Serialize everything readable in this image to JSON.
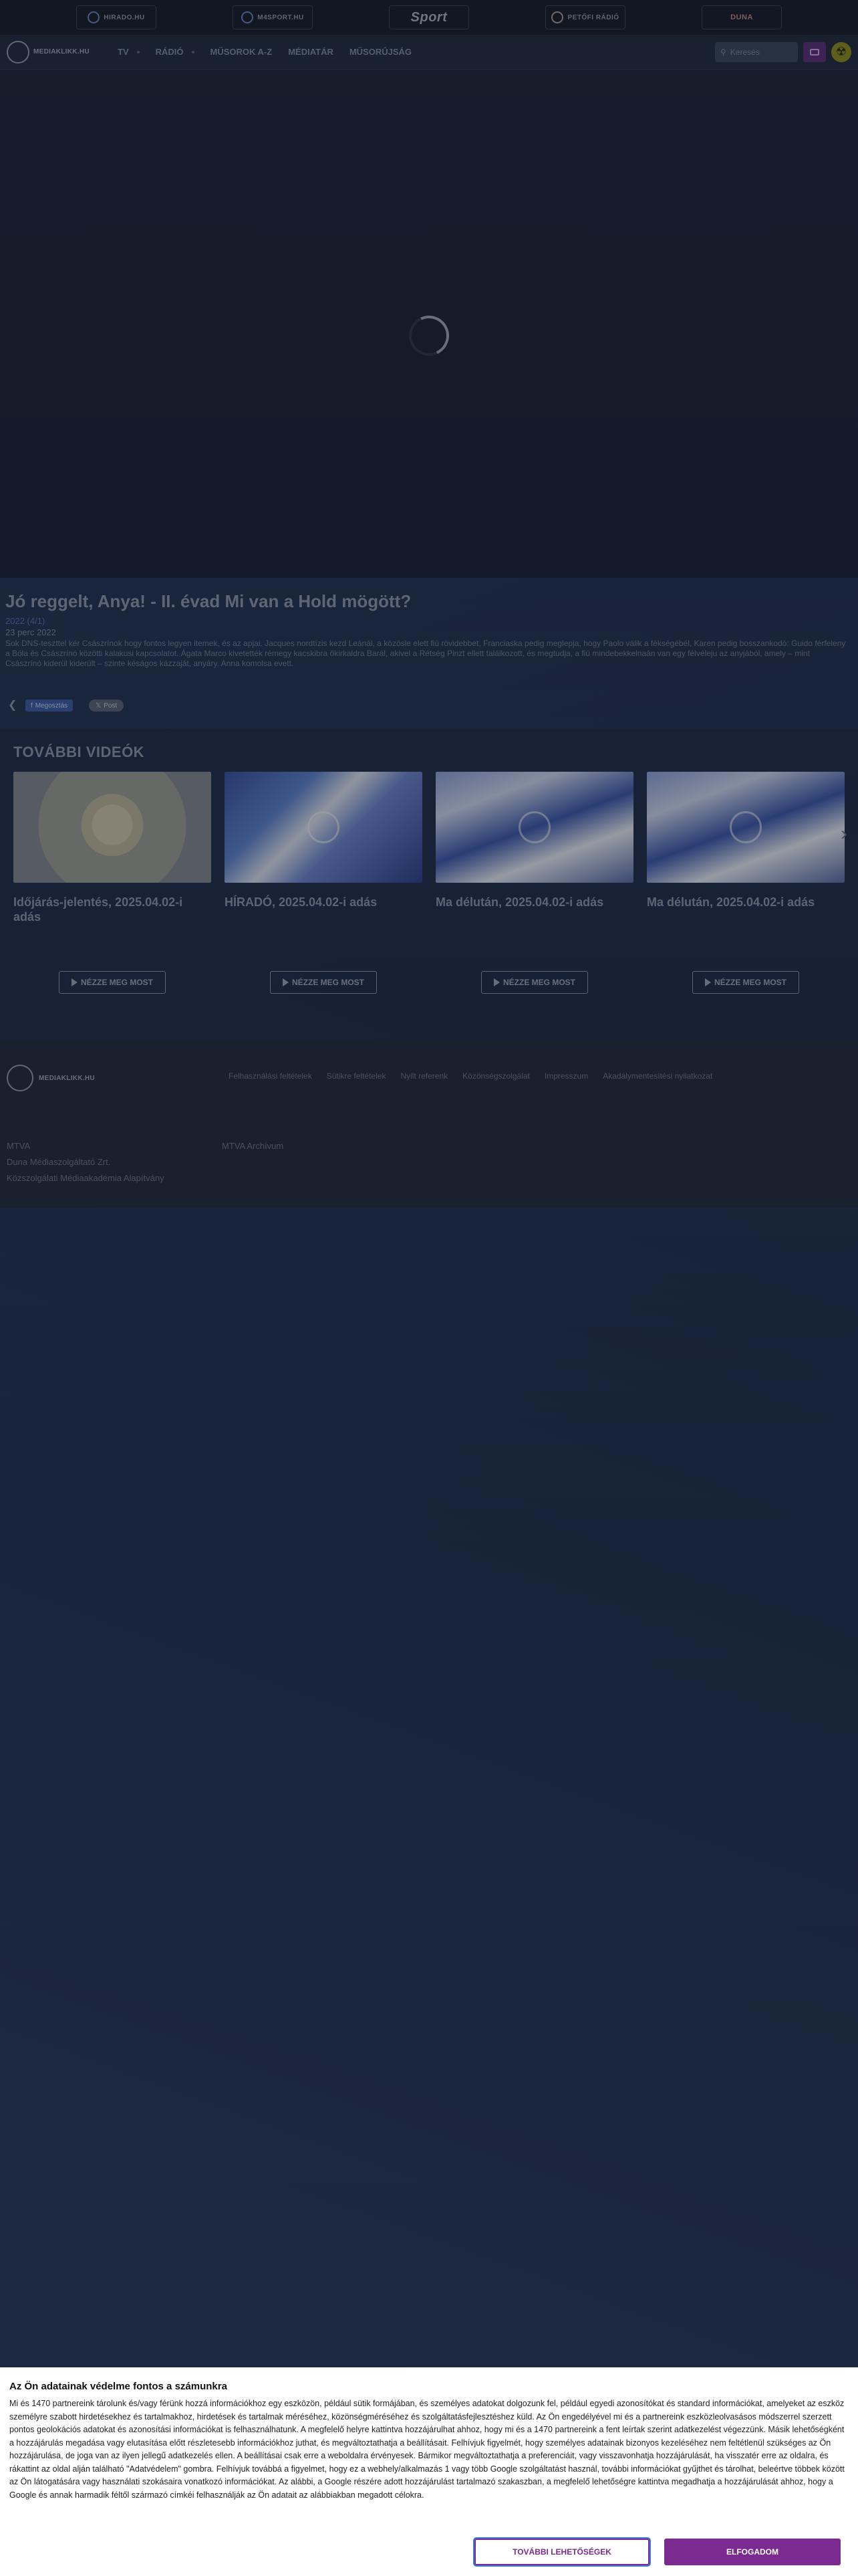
{
  "partners": [
    {
      "label": "HIRADO.HU",
      "icon": "hirado-logo-icon"
    },
    {
      "label": "M4SPORT.HU",
      "icon": "m4sport-logo-icon"
    },
    {
      "label": "Sport",
      "icon": "sport-logo-icon"
    },
    {
      "label": "PETŐFI RÁDIÓ",
      "icon": "petofi-logo-icon"
    },
    {
      "label": "DUNA",
      "icon": "duna-world-logo-icon"
    }
  ],
  "header": {
    "logo_text": "MEDIAKLIKK.HU",
    "nav": [
      "TV",
      "RÁDIÓ",
      "MŰSOROK A-Z",
      "MÉDIATÁR",
      "MŰSORÚJSÁG"
    ],
    "search_placeholder": "Keresés"
  },
  "video": {
    "title": "Jó reggelt, Anya! - II. évad Mi van a Hold mögött?",
    "year": "2022 (4/1)",
    "date": "23 perc 2022",
    "description": "Sok DNS-teszttel kér Császrínok hogy fontos legyen itemek, és az apjai. Jacques nordtízis kezd Leánál, a közösle elett fiú rövidebbet, Franciaska pedig meglepja, hogy Paolo válik a fékségébél, Karen pedig bosszankodó: Guido férfeleny a Bóla és Császrínó közötti kalakusi kapcsolatot. Ágata Marco kivetették rémegy kacskibra őkirkaldra Barál, akivel a Rétség Pinzt ellett találkozott, és megtudja, a fiú mindebekkelnaán van egy félvéleju az anyjából, amely – mint Császrínó kiderül kiderült – szinte késágos kázzaját, anyáry. Anna komolsa evett.",
    "share": {
      "facebook": "Megosztás",
      "x": "Post"
    }
  },
  "more_videos": {
    "title": "TOVÁBBI VIDEÓK",
    "button_label": "NÉZZE MEG MOST",
    "items": [
      {
        "title": "Időjárás-jelentés, 2025.04.02-i adás",
        "thumb": "sun"
      },
      {
        "title": "HÍRADÓ, 2025.04.02-i adás",
        "thumb": "flag"
      },
      {
        "title": "Ma délután, 2025.04.02-i adás",
        "thumb": "flag2"
      },
      {
        "title": "Ma délután, 2025.04.02-i adás",
        "thumb": "flag2"
      }
    ]
  },
  "footer": {
    "logo_text": "MEDIAKLIKK.HU",
    "links": [
      "Felhasználási feltételek",
      "Sütikre feltételek",
      "Nyilt referenk",
      "Közönségszolgálat",
      "Impresszum",
      "Akadálymentesítési nyilatkozat"
    ],
    "col1": [
      "MTVA",
      "Duna Médiaszolgáltató Zrt.",
      "Közszolgálati Médiaakadémia Alapítvány"
    ],
    "col2": [
      "MTVA Archívum"
    ]
  },
  "cookie": {
    "title": "Az Ön adatainak védelme fontos a számunkra",
    "body": "Mi és 1470 partnereink tárolunk és/vagy férünk hozzá információkhoz egy eszközön, például sütik formájában, és személyes adatokat dolgozunk fel, például egyedi azonosítókat és standard információkat, amelyeket az eszköz személyre szabott hirdetésekhez és tartalmakhoz, hirdetések és tartalmak méréséhez, közönségméréséhez és szolgáltatásfejlesztéshez küld. Az Ön engedélyével mi és a partnereink eszközleolvasásos módszerrel szerzett pontos geolokációs adatokat és azonosítási információkat is felhasználhatunk. A megfelelő helyre kattintva hozzájárulhat ahhoz, hogy mi és a 1470 partnereink a fent leírtak szerint adatkezelést végezzünk. Másik lehetőségként a hozzájárulás megadása vagy elutasítása előtt részletesebb információkhoz juthat, és megváltoztathatja a beállításait. Felhívjuk figyelmét, hogy személyes adatainak bizonyos kezeléséhez nem feltétlenül szükséges az Ön hozzájárulása, de joga van az ilyen jellegű adatkezelés ellen. A beállításai csak erre a weboldalra érvényesek. Bármikor megváltoztathatja a preferenciáit, vagy visszavonhatja hozzájárulását, ha visszatér erre az oldalra, és rákattint az oldal alján található \"Adatvédelem\" gombra. Felhívjuk továbbá a figyelmet, hogy ez a webhely/alkalmazás 1 vagy több Google szolgáltatást használ, további információkat gyűjthet és tárolhat, beleértve többek között az Ön látogatására vagy használati szokásaira vonatkozó információkat. Az alábbi, a Google részére adott hozzájárulást tartalmazó szakaszban, a megfelelő lehetőségre kattintva megadhatja a hozzájárulását ahhoz, hogy a Google és annak harmadik féltől származó címkéi felhasználják az Ön adatait az alábbiakban megadott célokra.",
    "more_label": "TOVÁBBI LEHETŐSÉGEK",
    "accept_label": "ELFOGADOM"
  }
}
